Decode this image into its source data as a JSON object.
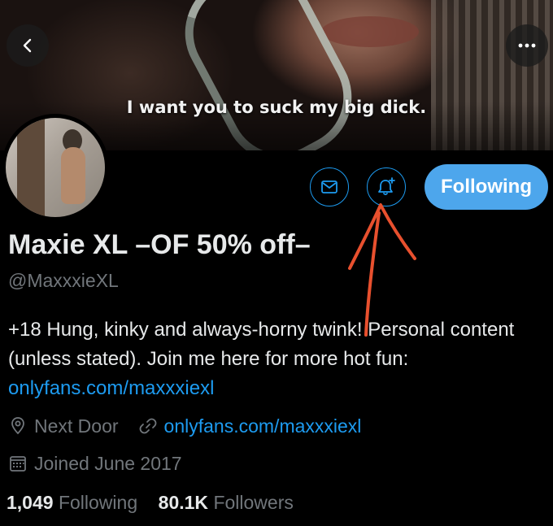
{
  "banner": {
    "caption": "I want you to suck my big dick."
  },
  "header": {
    "back_icon": "chevron-left-icon",
    "more_icon": "more-horizontal-icon"
  },
  "actions": {
    "message_icon": "mail-icon",
    "notify_icon": "bell-plus-icon",
    "follow_label": "Following",
    "accent_color": "#1d9bf0",
    "follow_bg": "#4da6ec"
  },
  "profile": {
    "display_name": "Maxie XL –OF 50% off–",
    "handle": "@MaxxxieXL",
    "bio_text": "+18 Hung, kinky and always-horny twink! Personal content (unless stated). Join me here for more hot fun: ",
    "bio_link": "onlyfans.com/maxxxiexl",
    "location": "Next Door",
    "website": "onlyfans.com/maxxxiexl",
    "joined": "Joined June 2017"
  },
  "stats": {
    "following_count": "1,049",
    "following_label": "Following",
    "followers_count": "80.1K",
    "followers_label": "Followers"
  },
  "annotation": {
    "color": "#e8502e",
    "points_to": "bell-plus-icon"
  }
}
